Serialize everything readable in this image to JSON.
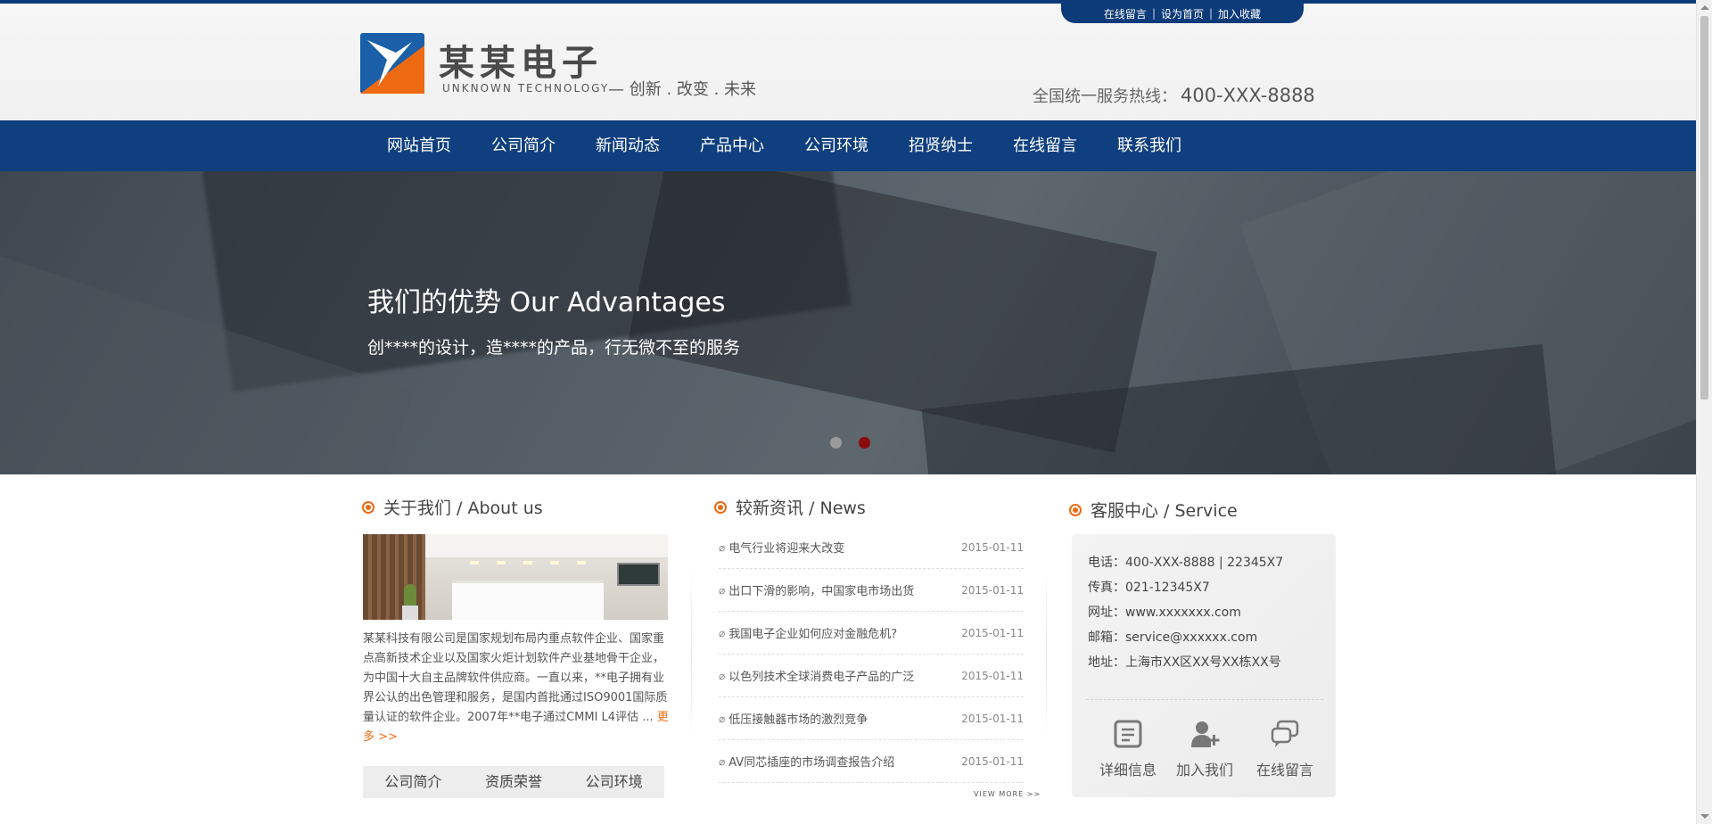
{
  "toplinks": {
    "message": "在线留言",
    "homepage": "设为首页",
    "favorite": "加入收藏",
    "sep": "|"
  },
  "header": {
    "brand": "某某电子",
    "brand_en": "UNKNOWN TECHNOLOGY",
    "slogan": "— 创新 . 改变 . 未来",
    "hotline_label": "全国统一服务热线：",
    "hotline_number": "400-XXX-8888"
  },
  "nav": {
    "items": [
      "网站首页",
      "公司简介",
      "新闻动态",
      "产品中心",
      "公司环境",
      "招贤纳士",
      "在线留言",
      "联系我们"
    ]
  },
  "banner": {
    "title": "我们的优势 Our Advantages",
    "subtitle": "创****的设计，造****的产品，行无微不至的服务",
    "slide_count": 2,
    "active_slide": 2
  },
  "about": {
    "title": "关于我们 / About us",
    "text": "某某科技有限公司是国家规划布局内重点软件企业、国家重点高新技术企业以及国家火炬计划软件产业基地骨干企业，为中国十大自主品牌软件供应商。一直以来，**电子拥有业界公认的出色管理和服务，是国内首批通过ISO9001国际质量认证的软件企业。2007年**电子通过CMMI L4评估 ...",
    "more": "更多 >>",
    "tabs": [
      "公司简介",
      "资质荣誉",
      "公司环境"
    ]
  },
  "news": {
    "title": "较新资讯 / News",
    "items": [
      {
        "title": "电气行业将迎来大改变",
        "date": "2015-01-11"
      },
      {
        "title": "出口下滑的影响，中国家电市场出货",
        "date": "2015-01-11"
      },
      {
        "title": "我国电子企业如何应对金融危机?",
        "date": "2015-01-11"
      },
      {
        "title": "以色列技术全球消费电子产品的广泛",
        "date": "2015-01-11"
      },
      {
        "title": "低压接触器市场的激烈竞争",
        "date": "2015-01-11"
      },
      {
        "title": "AV同芯插座的市场调查报告介绍",
        "date": "2015-01-11"
      }
    ],
    "view_more": "VIEW MORE >>"
  },
  "service": {
    "title": "客服中心 / Service",
    "phone": "电话：400-XXX-8888 | 22345X7",
    "fax": "传真：021-12345X7",
    "website": "网址：www.xxxxxxx.com",
    "email": "邮箱：service@xxxxxx.com",
    "address": "地址：上海市XX区XX号XX栋XX号",
    "buttons": [
      "详细信息",
      "加入我们",
      "在线留言"
    ]
  },
  "colors": {
    "nav": "#0f3f7e",
    "accent": "#ee6a12",
    "active_dot": "#8b0a0a"
  }
}
